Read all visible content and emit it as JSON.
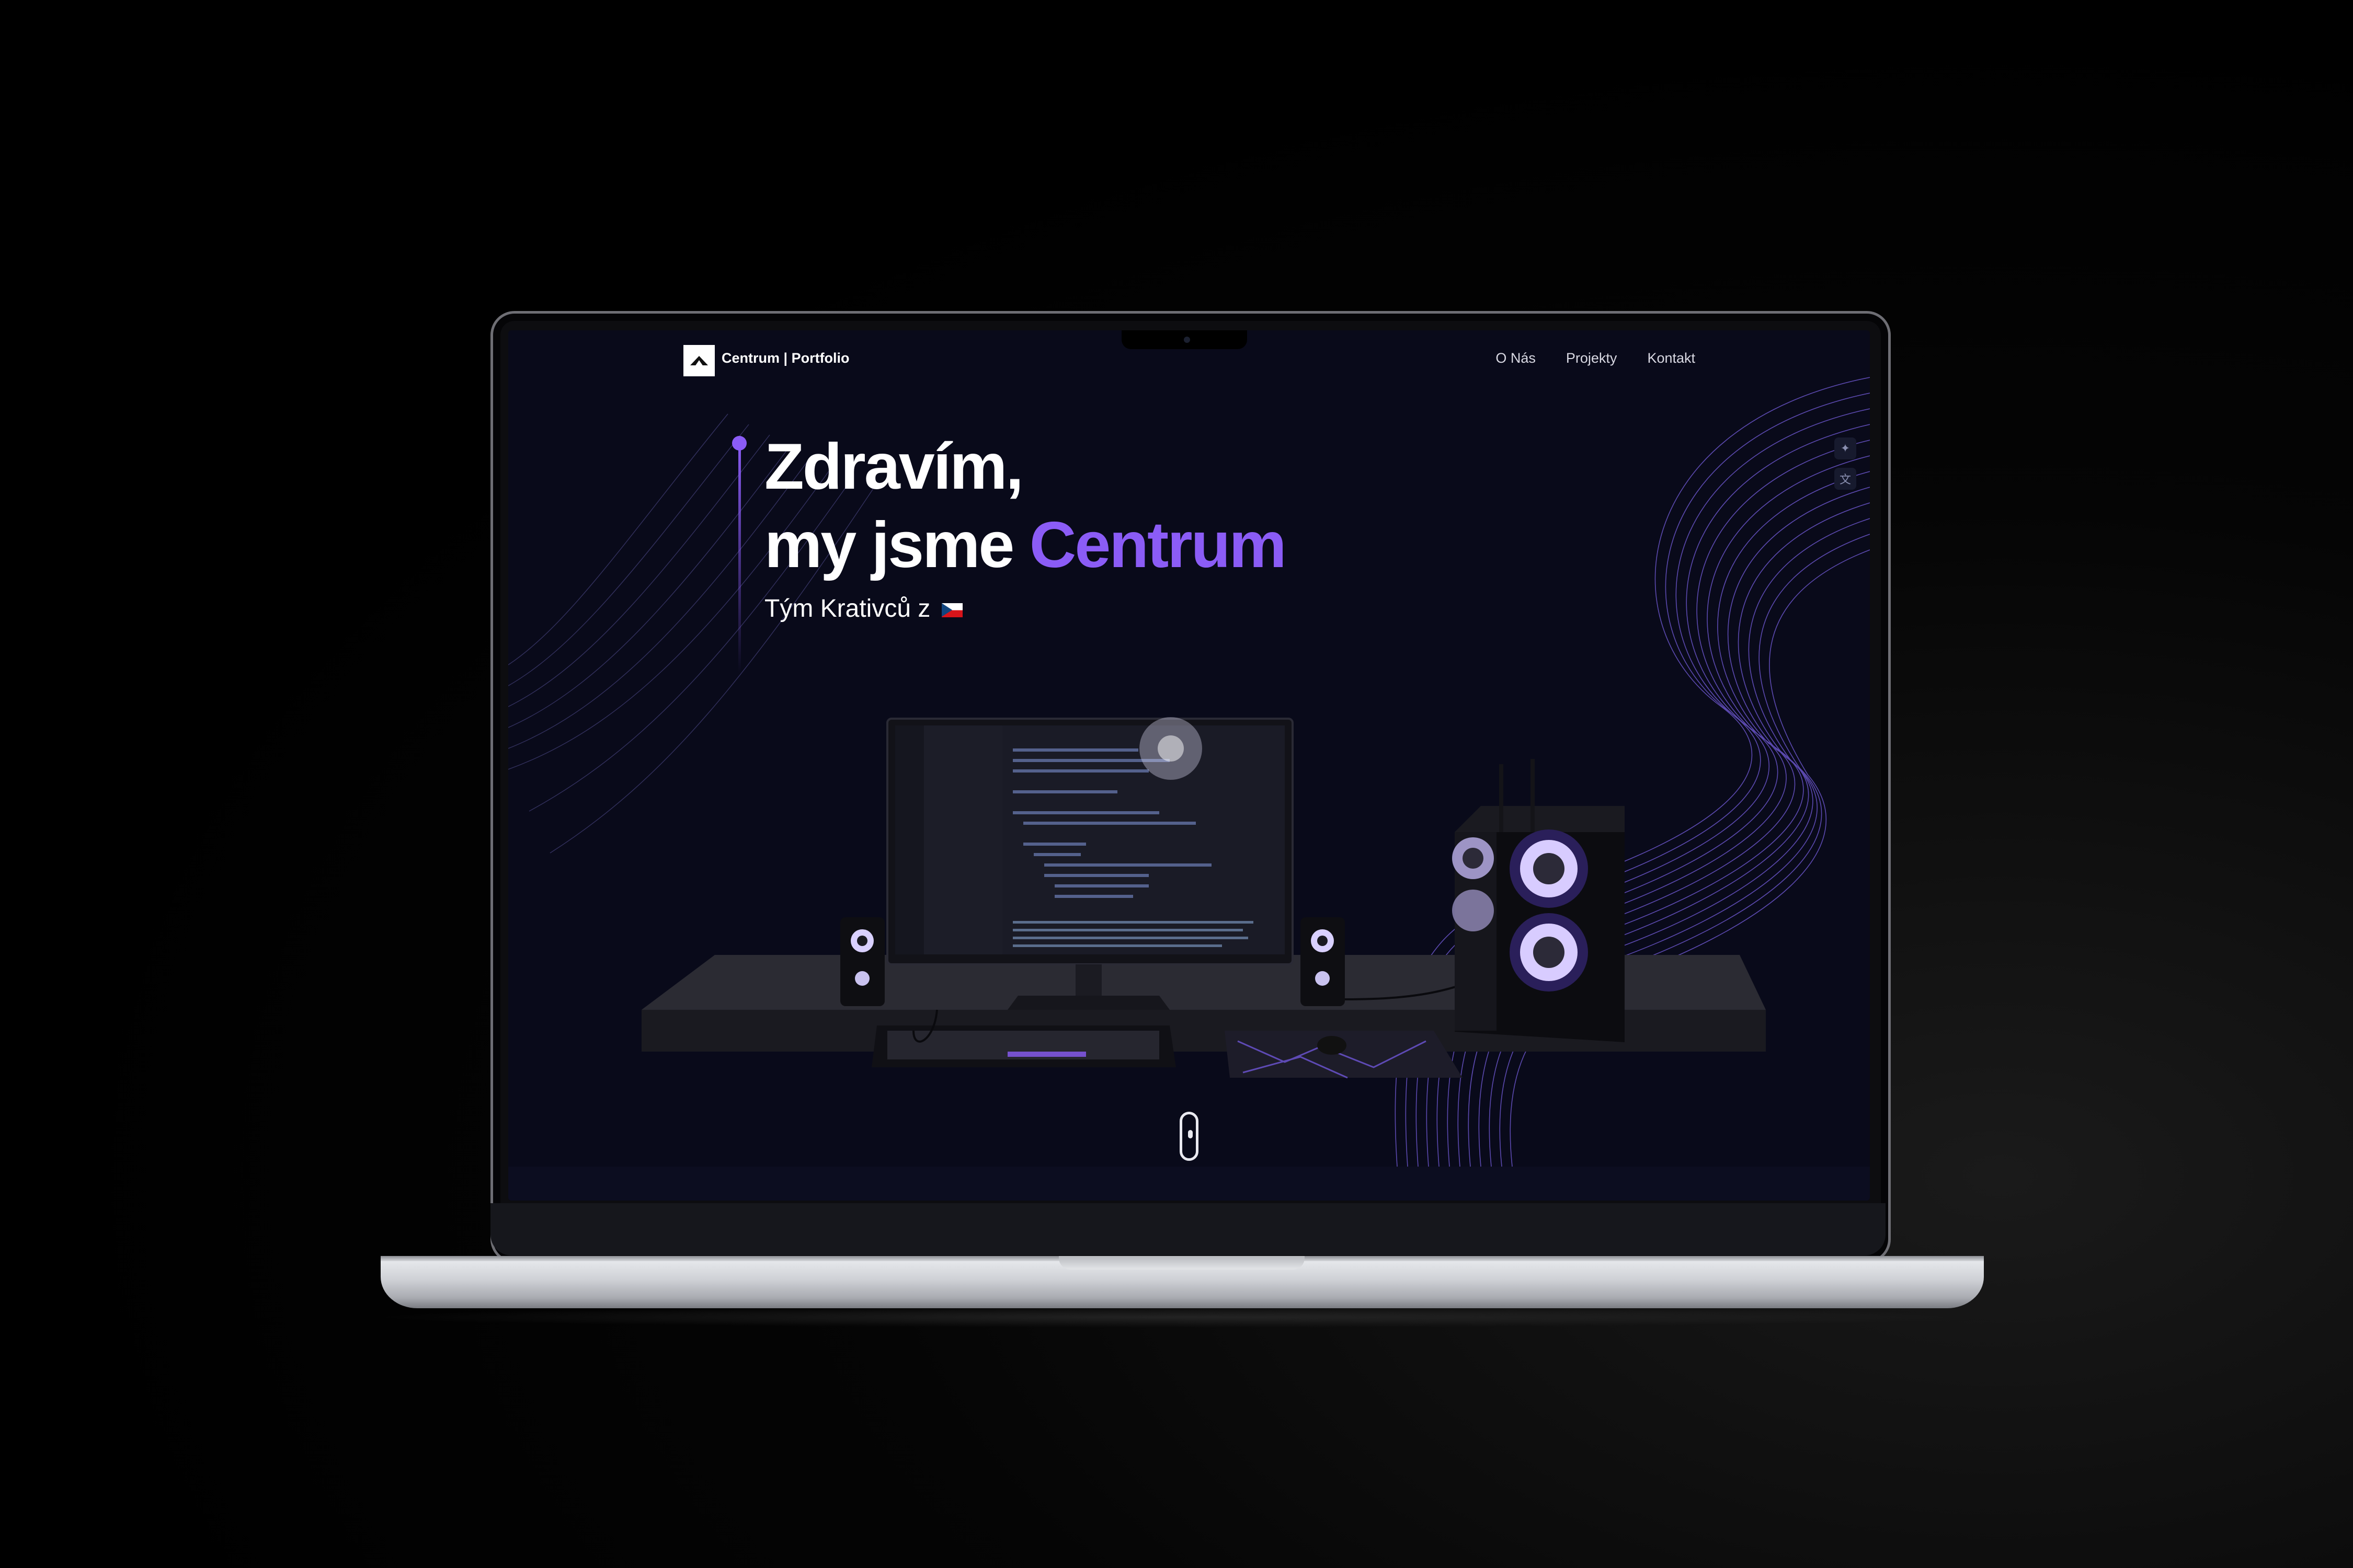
{
  "nav": {
    "brand": "Centrum | Portfolio",
    "links": [
      "O Nás",
      "Projekty",
      "Kontakt"
    ]
  },
  "hero": {
    "greeting": "Zdravím,",
    "line2_prefix": "my jsme ",
    "line2_accent": "Centrum",
    "subtitle": "Tým Krativců z"
  },
  "side_icons": [
    "sparkle-icon",
    "translate-icon"
  ],
  "colors": {
    "accent": "#8b5cf6",
    "background": "#090a1a",
    "text": "#ffffff"
  }
}
